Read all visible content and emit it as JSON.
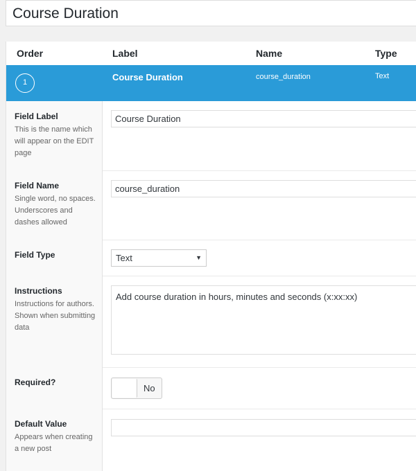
{
  "page_title": "Course Duration",
  "columns": {
    "order": "Order",
    "label": "Label",
    "name": "Name",
    "type": "Type"
  },
  "field": {
    "order": "1",
    "label": "Course Duration",
    "name": "course_duration",
    "type": "Text"
  },
  "settings": {
    "field_label": {
      "title": "Field Label",
      "description": "This is the name which will appear on the EDIT page",
      "value": "Course Duration"
    },
    "field_name": {
      "title": "Field Name",
      "description": "Single word, no spaces. Underscores and dashes allowed",
      "value": "course_duration"
    },
    "field_type": {
      "title": "Field Type",
      "value": "Text"
    },
    "instructions": {
      "title": "Instructions",
      "description": "Instructions for authors. Shown when submitting data",
      "value": "Add course duration in hours, minutes and seconds (x:xx:xx)"
    },
    "required": {
      "title": "Required?",
      "value": "No"
    },
    "default_value": {
      "title": "Default Value",
      "description": "Appears when creating a new post",
      "value": ""
    }
  },
  "colors": {
    "accent": "#2a9bd8"
  }
}
